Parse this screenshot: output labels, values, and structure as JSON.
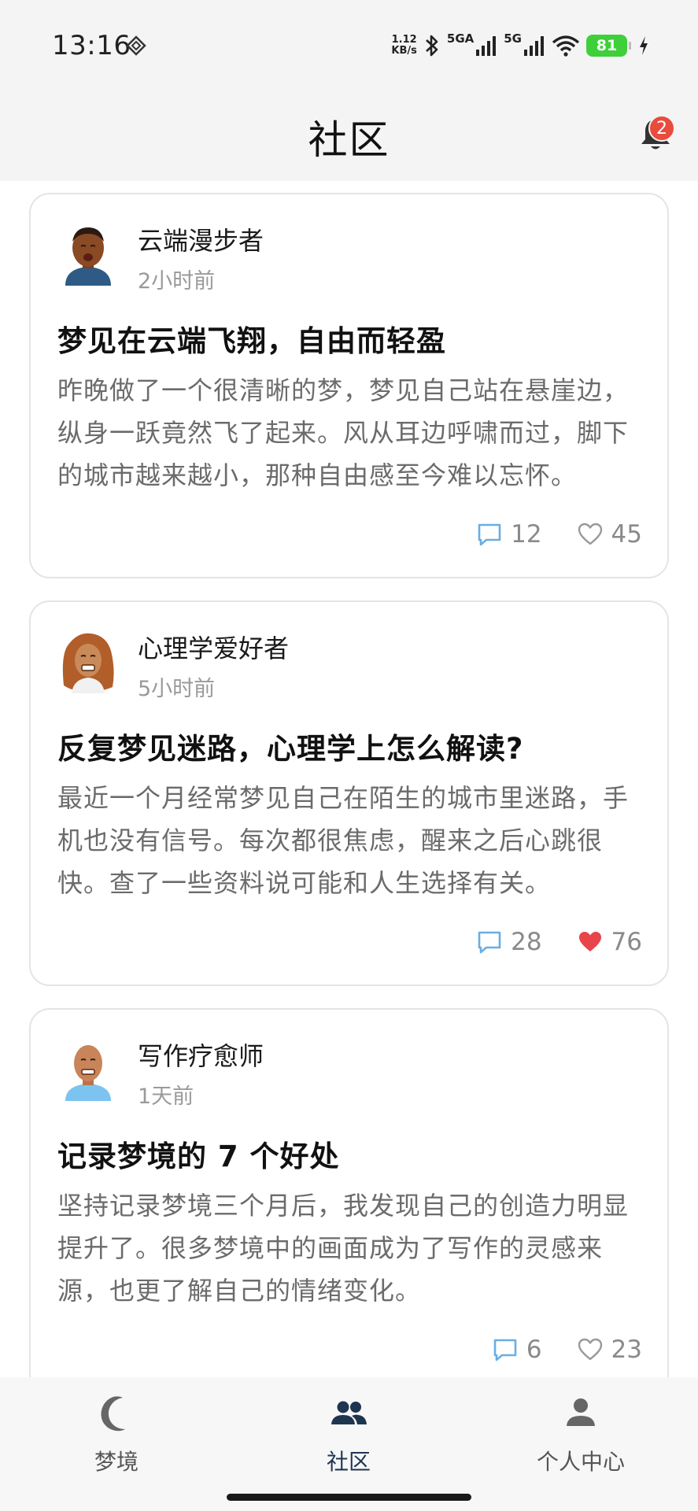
{
  "status_bar": {
    "time": "13:16",
    "net_speed_value": "1.12",
    "net_speed_unit": "KB/s",
    "sim1_label": "5GA",
    "sim2_label": "5G",
    "battery": "81"
  },
  "header": {
    "title": "社区",
    "notification_count": "2"
  },
  "posts": [
    {
      "author": "云端漫步者",
      "time": "2小时前",
      "title": "梦见在云端飞翔，自由而轻盈",
      "body": "昨晚做了一个很清晰的梦，梦见自己站在悬崖边，纵身一跃竟然飞了起来。风从耳边呼啸而过，脚下的城市越来越小，那种自由感至今难以忘怀。",
      "comments": "12",
      "likes": "45",
      "liked": false
    },
    {
      "author": "心理学爱好者",
      "time": "5小时前",
      "title": "反复梦见迷路，心理学上怎么解读?",
      "body": "最近一个月经常梦见自己在陌生的城市里迷路，手机也没有信号。每次都很焦虑，醒来之后心跳很快。查了一些资料说可能和人生选择有关。",
      "comments": "28",
      "likes": "76",
      "liked": true
    },
    {
      "author": "写作疗愈师",
      "time": "1天前",
      "title": "记录梦境的 7 个好处",
      "body": "坚持记录梦境三个月后，我发现自己的创造力明显提升了。很多梦境中的画面成为了写作的灵感来源，也更了解自己的情绪变化。",
      "comments": "6",
      "likes": "23",
      "liked": false
    }
  ],
  "bottom_nav": {
    "items": [
      {
        "label": "梦境",
        "icon": "moon-icon"
      },
      {
        "label": "社区",
        "icon": "community-icon",
        "active": true
      },
      {
        "label": "个人中心",
        "icon": "person-icon"
      }
    ]
  },
  "colors": {
    "accent": "#1e3550",
    "comment_icon": "#6aaee3",
    "liked_heart": "#e8444a",
    "badge": "#e94b3c"
  }
}
